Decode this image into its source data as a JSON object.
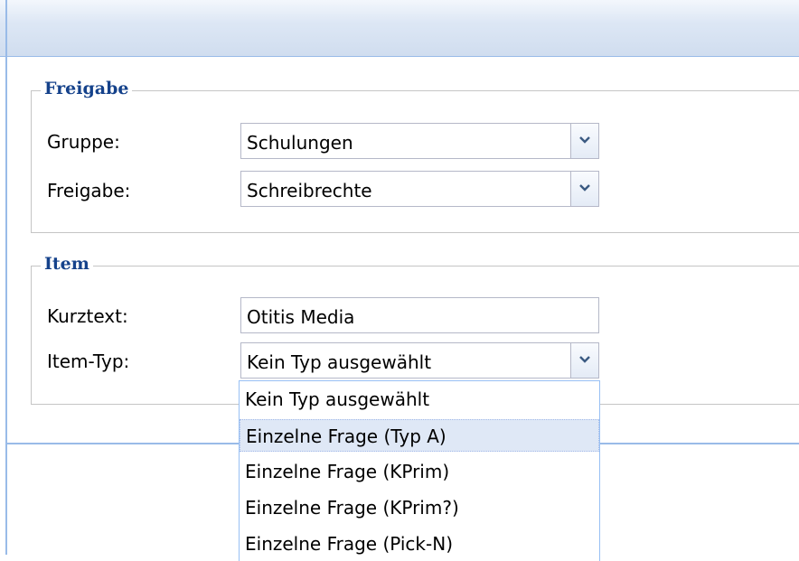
{
  "freigabe_section": {
    "legend": "Freigabe",
    "gruppe": {
      "label": "Gruppe:",
      "value": "Schulungen"
    },
    "freigabe": {
      "label": "Freigabe:",
      "value": "Schreibrechte"
    }
  },
  "item_section": {
    "legend": "Item",
    "kurztext": {
      "label": "Kurztext:",
      "value": "Otitis Media"
    },
    "item_typ": {
      "label": "Item-Typ:",
      "value": "Kein Typ ausgewählt"
    }
  },
  "dropdown": {
    "options": [
      "Kein Typ ausgewählt",
      "Einzelne Frage (Typ A)",
      "Einzelne Frage (KPrim)",
      "Einzelne Frage (KPrim?)",
      "Einzelne Frage (Pick-N)"
    ],
    "highlighted_index": 1
  },
  "icons": {
    "combo_trigger": "chevron-down-icon"
  },
  "colors": {
    "legend": "#15428b",
    "panel_border": "#99bbe8",
    "highlight": "#dfe8f6"
  }
}
